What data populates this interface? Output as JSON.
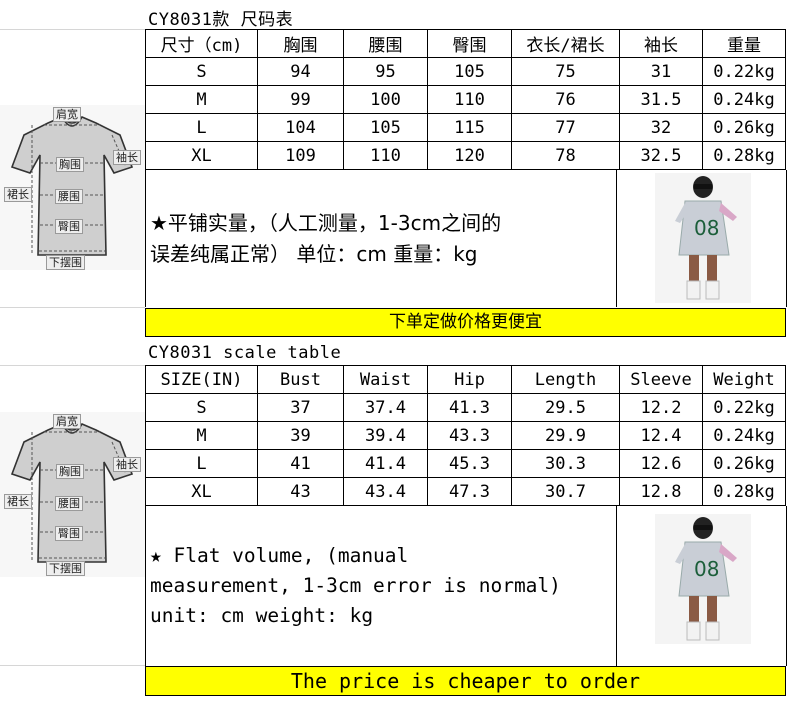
{
  "diagram_labels": {
    "shoulder": "肩宽",
    "sleeve": "袖长",
    "chest": "胸围",
    "length": "裙长",
    "waist": "腰围",
    "hip": "臀围",
    "hem": "下摆围"
  },
  "cn": {
    "title": "CY8031款 尺码表",
    "headers": [
      "尺寸（cm)",
      "胸围",
      "腰围",
      "臀围",
      "衣长/裙长",
      "袖长",
      "重量"
    ],
    "rows": [
      [
        "S",
        "94",
        "95",
        "105",
        "75",
        "31",
        "0.22kg"
      ],
      [
        "M",
        "99",
        "100",
        "110",
        "76",
        "31.5",
        "0.24kg"
      ],
      [
        "L",
        "104",
        "105",
        "115",
        "77",
        "32",
        "0.26kg"
      ],
      [
        "XL",
        "109",
        "110",
        "120",
        "78",
        "32.5",
        "0.28kg"
      ]
    ],
    "note_line1": "★平铺实量，（人工测量，1-3cm之间的",
    "note_line2": "误差纯属正常） 单位：cm  重量：kg",
    "banner": "下单定做价格更便宜"
  },
  "en": {
    "title": "CY8031 scale table",
    "headers": [
      "SIZE(IN)",
      "Bust",
      "Waist",
      "Hip",
      "Length",
      "Sleeve",
      "Weight"
    ],
    "rows": [
      [
        "S",
        "37",
        "37.4",
        "41.3",
        "29.5",
        "12.2",
        "0.22kg"
      ],
      [
        "M",
        "39",
        "39.4",
        "43.3",
        "29.9",
        "12.4",
        "0.24kg"
      ],
      [
        "L",
        "41",
        "41.4",
        "45.3",
        "30.3",
        "12.6",
        "0.26kg"
      ],
      [
        "XL",
        "43",
        "43.4",
        "47.3",
        "30.7",
        "12.8",
        "0.28kg"
      ]
    ],
    "note_line1": "★ Flat volume, (manual",
    "note_line2": "measurement, 1-3cm error is normal)",
    "note_line3": "unit: cm weight: kg",
    "banner": "The price is cheaper to order"
  }
}
